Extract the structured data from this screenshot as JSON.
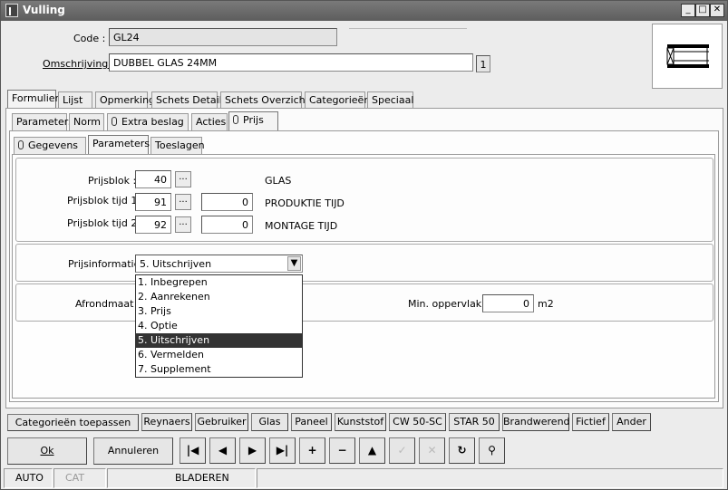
{
  "window": {
    "title": "Vulling",
    "controls": [
      "_",
      "□",
      "✕"
    ]
  },
  "fields": {
    "code_label": "Code :",
    "code_value": "GL24",
    "omschrijving_label": "Omschrijving :",
    "omschrijving_value": "DUBBEL GLAS 24MM",
    "omschrijving_count": "1"
  },
  "main_tabs": [
    "Formulier",
    "Lijst",
    "Opmerking",
    "Schets Detail",
    "Schets Overzicht",
    "Categorieën",
    "Speciaal"
  ],
  "sub_tabs": [
    "Parameters",
    "Norm",
    "Extra beslag",
    "Acties",
    "Prijs"
  ],
  "prijs_tabs": [
    "Gegevens",
    "Parameters",
    "Toeslagen"
  ],
  "prijsblok": {
    "label": "Prijsblok :",
    "value": "40",
    "desc": "GLAS",
    "tijd1_label": "Prijsblok tijd 1 :",
    "tijd1_value": "91",
    "tijd1_extra": "0",
    "tijd1_desc": "PRODUKTIE TIJD",
    "tijd2_label": "Prijsblok tijd 2 :",
    "tijd2_value": "92",
    "tijd2_extra": "0",
    "tijd2_desc": "MONTAGE TIJD",
    "dots": "..."
  },
  "prijsinformatie": {
    "label": "Prijsinformatie :",
    "selected": "5.  Uitschrijven",
    "options": [
      "1.  Inbegrepen",
      "2.  Aanrekenen",
      "3.  Prijs",
      "4.  Optie",
      "5.  Uitschrijven",
      "6.  Vermelden",
      "7.  Supplement"
    ]
  },
  "afrond": {
    "label": "Afrondmaat :",
    "min_label": "Min. oppervlak :",
    "min_value": "0",
    "unit": "m2"
  },
  "category_buttons": [
    "Categorieën toepassen",
    "Reynaers",
    "Gebruiker",
    "Glas",
    "Paneel",
    "Kunststof",
    "CW 50-SC",
    "STAR 50",
    "Brandwerend",
    "Fictief",
    "Ander"
  ],
  "actions": {
    "ok": "Ok",
    "annuleren": "Annuleren"
  },
  "nav_glyphs": [
    "|◀",
    "◀",
    "▶",
    "▶|",
    "+",
    "−",
    "▲",
    "✓",
    "✕",
    "↻",
    "⚲"
  ],
  "status": [
    "AUTO",
    "CAT",
    "BLADEREN"
  ]
}
